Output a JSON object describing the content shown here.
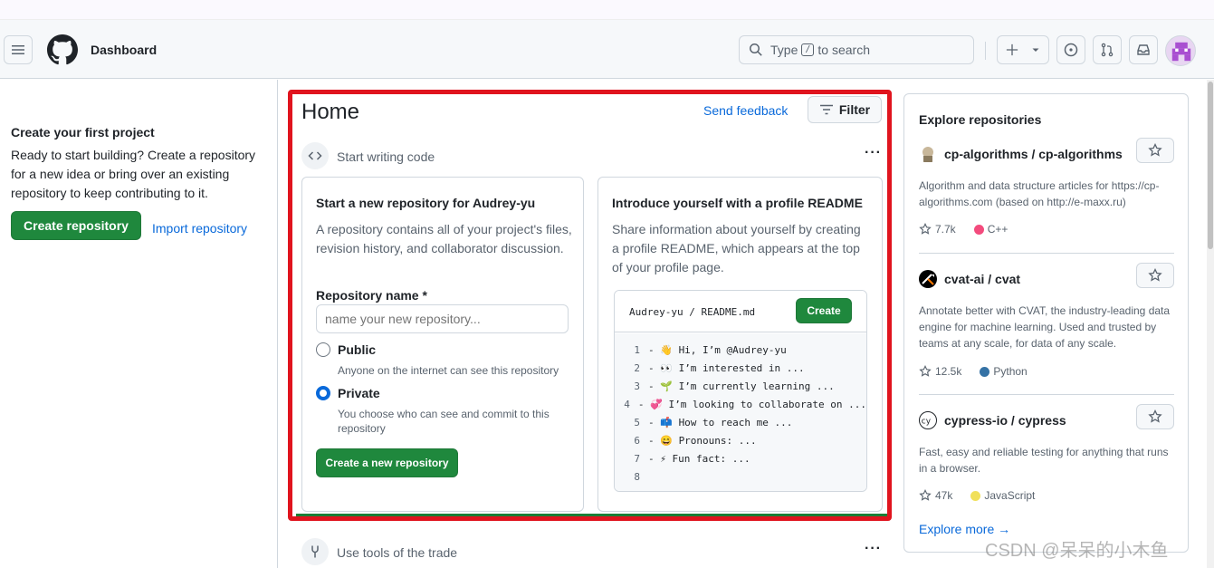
{
  "header": {
    "title": "Dashboard",
    "search": {
      "prefix": "Type",
      "key": "/",
      "suffix": "to search"
    },
    "icons": [
      "menu-icon",
      "github-logo-icon",
      "search-icon",
      "plus-icon",
      "chevron-down-icon",
      "issue-icon",
      "pull-request-icon",
      "inbox-icon"
    ]
  },
  "left": {
    "title": "Create your first project",
    "text": "Ready to start building? Create a repository for a new idea or bring over an existing repository to keep contributing to it.",
    "create_label": "Create repository",
    "import_label": "Import repository"
  },
  "home": {
    "title": "Home",
    "feedback_label": "Send feedback",
    "filter_label": "Filter",
    "section1_label": "Start writing code",
    "section2_label": "Use tools of the trade"
  },
  "new_repo": {
    "title": "Start a new repository for Audrey-yu",
    "desc": "A repository contains all of your project's files, revision history, and collaborator discussion.",
    "name_label": "Repository name *",
    "name_placeholder": "name your new repository...",
    "public_label": "Public",
    "public_desc": "Anyone on the internet can see this repository",
    "private_label": "Private",
    "private_desc": "You choose who can see and commit to this repository",
    "selected": "Private",
    "create_label": "Create a new repository"
  },
  "readme": {
    "title": "Introduce yourself with a profile README",
    "desc": "Share information about yourself by creating a profile README, which appears at the top of your profile page.",
    "path_user": "Audrey-yu",
    "path_sep": "/",
    "path_file": "README.md",
    "create_label": "Create",
    "lines": [
      {
        "n": "1",
        "text": "- 👋 Hi, I’m @Audrey-yu"
      },
      {
        "n": "2",
        "text": "- 👀 I’m interested in ..."
      },
      {
        "n": "3",
        "text": "- 🌱 I’m currently learning ..."
      },
      {
        "n": "4",
        "text": "- 💞️ I’m looking to collaborate on ..."
      },
      {
        "n": "5",
        "text": "- 📫 How to reach me ..."
      },
      {
        "n": "6",
        "text": "- 😄 Pronouns: ..."
      },
      {
        "n": "7",
        "text": "- ⚡ Fun fact: ..."
      },
      {
        "n": "8",
        "text": ""
      }
    ]
  },
  "explore": {
    "title": "Explore repositories",
    "more_label": "Explore more →",
    "repos": [
      {
        "owner": "cp-algorithms",
        "sep": " / ",
        "name": "cp-algorithms",
        "desc": "Algorithm and data structure articles for https://cp-algorithms.com (based on http://e-maxx.ru)",
        "stars": "7.7k",
        "language": "C++",
        "lang_color": "#f34b7d"
      },
      {
        "owner": "cvat-ai",
        "sep": " / ",
        "name": "cvat",
        "desc": "Annotate better with CVAT, the industry-leading data engine for machine learning. Used and trusted by teams at any scale, for data of any scale.",
        "stars": "12.5k",
        "language": "Python",
        "lang_color": "#3572A5"
      },
      {
        "owner": "cypress-io",
        "sep": " / ",
        "name": "cypress",
        "desc": "Fast, easy and reliable testing for anything that runs in a browser.",
        "stars": "47k",
        "language": "JavaScript",
        "lang_color": "#f1e05a"
      }
    ]
  },
  "colors": {
    "accent": "#0969da",
    "primary_button": "#1f883d",
    "highlight_red": "#e0141e",
    "highlight_green": "#1a7f37"
  },
  "watermark": "CSDN @呆呆的小木鱼"
}
